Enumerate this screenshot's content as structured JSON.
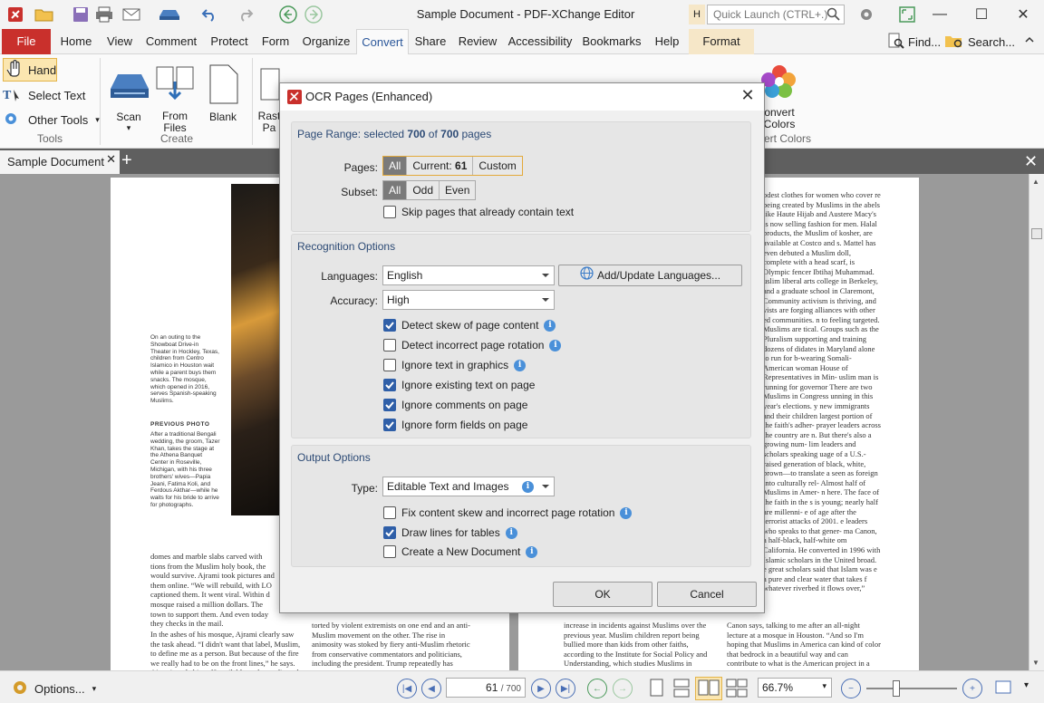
{
  "window": {
    "title": "Sample Document - PDF-XChange Editor",
    "quick_launch_placeholder": "Quick Launch (CTRL+.)",
    "minimize": "—",
    "maximize": "☐",
    "close": "✕"
  },
  "ribbon_tabs": [
    "File",
    "Home",
    "View",
    "Comment",
    "Protect",
    "Form",
    "Organize",
    "Convert",
    "Share",
    "Review",
    "Accessibility",
    "Bookmarks",
    "Help",
    "Format"
  ],
  "ribbon_right": {
    "find": "Find...",
    "search": "Search..."
  },
  "tools": {
    "hand": "Hand",
    "select_text": "Select Text",
    "other_tools": "Other Tools",
    "group": "Tools"
  },
  "create": {
    "scan": "Scan",
    "from_files": "From Files",
    "blank": "Blank",
    "group": "Create"
  },
  "convert_partial": {
    "raster": "Rast",
    "pa": "Pa",
    "convert_colors": "Convert Colors",
    "convert_colors_line1": "onvert",
    "convert_colors_line2": "Colors",
    "group_partial": "vert Colors"
  },
  "document_tab": "Sample Document",
  "dialog": {
    "title": "OCR Pages (Enhanced)",
    "page_range": {
      "prefix": "Page Range: selected ",
      "selected": "700",
      "of": " of ",
      "total": "700",
      "suffix": " pages"
    },
    "pages_label": "Pages:",
    "pages_options": {
      "all": "All",
      "current_prefix": "Current: ",
      "current_num": "61",
      "custom": "Custom"
    },
    "subset_label": "Subset:",
    "subset_options": [
      "All",
      "Odd",
      "Even"
    ],
    "skip_pages": "Skip pages that already contain text",
    "recognition_title": "Recognition Options",
    "languages_label": "Languages:",
    "languages_value": "English",
    "add_languages": "Add/Update Languages...",
    "accuracy_label": "Accuracy:",
    "accuracy_value": "High",
    "options": [
      {
        "label": "Detect skew of page content",
        "checked": true,
        "info": true
      },
      {
        "label": "Detect incorrect page rotation",
        "checked": false,
        "info": true
      },
      {
        "label": "Ignore text in graphics",
        "checked": false,
        "info": true
      },
      {
        "label": "Ignore existing text on page",
        "checked": true,
        "info": false
      },
      {
        "label": "Ignore comments on page",
        "checked": true,
        "info": false
      },
      {
        "label": "Ignore form fields on page",
        "checked": true,
        "info": false
      }
    ],
    "output_title": "Output Options",
    "type_label": "Type:",
    "type_value": "Editable Text and Images",
    "output_options": [
      {
        "label": "Fix content skew and incorrect page rotation",
        "checked": false,
        "info": true
      },
      {
        "label": "Draw lines for tables",
        "checked": true,
        "info": true
      },
      {
        "label": "Create a New Document",
        "checked": false,
        "info": true
      }
    ],
    "ok": "OK",
    "cancel": "Cancel"
  },
  "page_left": {
    "caption": "On an outing to the Showboat Drive-in Theater in Hockley, Texas, children from Centro Islamico in Houston wait while a parent buys them snacks. The mosque, which opened in 2016, serves Spanish-speaking Muslims.",
    "prev_photo": "PREVIOUS PHOTO",
    "caption2": "After a traditional Bengali wedding, the groom, Tazer Khan, takes the stage at the Athena Banquet Center in Roseville, Michigan, with his three brothers' wives—Papia Jeani, Fatima Koli, and Ferdous Akthar—while he waits for his bride to arrive for photographs.",
    "body1": "domes and marble slabs carved with tions from the Muslim holy book, the would survive. Ajrami took pictures and them online. “We will rebuild, with LO captioned them. It went viral. Within d mosque raised a million dollars. The town to support them. And even today they checks in the mail.",
    "body2": "In the ashes of his mosque, Ajrami clearly saw the task ahead. “I didn't want that label, Muslim, to define me as a person. But because of the fire we really had to be on the front lines,” he says. Ajrami made himself available to the media and",
    "body3": "torted by violent extremists on one end and an anti-Muslim movement on the other. The rise in animosity was stoked by fiery anti-Muslim rhetoric from conservative commentators and politicians, including the president. Trump repeatedly has described Islam as a threat"
  },
  "page_right": {
    "col_right": "odest clothes for women who cover re being created by Muslims in the abels like Haute Hijab and Austere Macy's is now selling fashion for men. Halal products, the Muslim of kosher, are available at Costco and s. Mattel has even debuted a Muslim doll, complete with a head scarf, is Olympic fencer Ibtihaj Muhammad. uslim liberal arts college in Berkeley, and a graduate school in Claremont, Community activism is thriving, and vists are forging alliances with other ed communities. n to feeling targeted. Muslims are tical. Groups such as the Pluralism supporting and training dozens of didates in Maryland alone to run for b-wearing Somali-American woman House of Representatives in Min- uslim man is running for governor There are two Muslims in Congress unning in this year's elections. y new immigrants and their children largest portion of the faith's adher- prayer leaders across the country are n. But there's also a growing num- lim leaders and scholars speaking uage of a U.S.-raised generation of black, white, brown—to translate a seen as foreign into culturally rel- Almost half of Muslims in Amer- n here. The face of the faith in the s is young; nearly half are millenni- e of age after the terrorist attacks of 2001. e leaders who speaks to that gener- ma Canon, a half-black, half-white om California. He converted in 1996 with Islamic scholars in the United broad. e great scholars said that Islam was e a pure and clear water that takes f whatever riverbed it flows over,”",
    "col_bottom_left": "increase in incidents against Muslims over the previous year. Muslim children report being bullied more than kids from other faiths, according to the Institute for Social Policy and Understanding, which studies Muslims in America. Half of American Muslims say that being Muslim has",
    "col_bottom_right": "Canon says, talking to me after an all-night lecture at a mosque in Houston. “And so I'm hoping that Muslims in America can kind of color that bedrock in a beautiful way and can contribute to what is the American project in a way that when that water flows over it, it has a"
  },
  "status": {
    "options": "Options...",
    "page_current": "61",
    "page_total": "/ 700",
    "zoom": "66.7%"
  }
}
